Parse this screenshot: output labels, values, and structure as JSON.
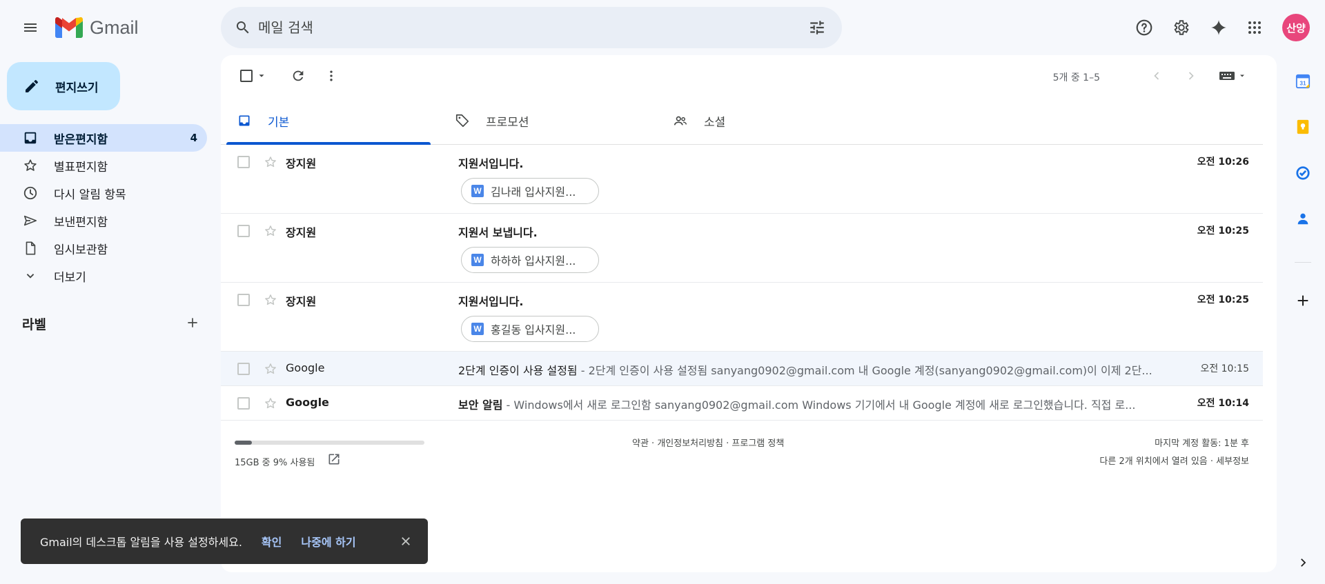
{
  "header": {
    "app_name": "Gmail",
    "search_placeholder": "메일 검색",
    "avatar_text": "산양"
  },
  "compose": {
    "label": "편지쓰기"
  },
  "nav": {
    "items": [
      {
        "label": "받은편지함",
        "count": "4",
        "icon": "inbox-icon",
        "active": true
      },
      {
        "label": "별표편지함",
        "icon": "star-icon"
      },
      {
        "label": "다시 알림 항목",
        "icon": "clock-icon"
      },
      {
        "label": "보낸편지함",
        "icon": "send-icon"
      },
      {
        "label": "임시보관함",
        "icon": "draft-icon"
      },
      {
        "label": "더보기",
        "icon": "chevron-down-icon"
      }
    ],
    "labels_heading": "라벨"
  },
  "toolbar": {
    "pager": "5개 중 1–5"
  },
  "tabs": [
    {
      "label": "기본",
      "icon": "inbox-icon",
      "active": true
    },
    {
      "label": "프로모션",
      "icon": "tag-icon"
    },
    {
      "label": "소셜",
      "icon": "people-icon"
    }
  ],
  "emails": [
    {
      "sender": "장지원",
      "subject": "지원서입니다.",
      "snippet": "",
      "time": "오전 10:26",
      "attachment": "김나래 입사지원...",
      "unread": true
    },
    {
      "sender": "장지원",
      "subject": "지원서 보냅니다.",
      "snippet": "",
      "time": "오전 10:25",
      "attachment": "하하하 입사지원...",
      "unread": true
    },
    {
      "sender": "장지원",
      "subject": "지원서입니다.",
      "snippet": "",
      "time": "오전 10:25",
      "attachment": "홍길동 입사지원...",
      "unread": true
    },
    {
      "sender": "Google",
      "subject": "2단계 인증이 사용 설정됨",
      "snippet": " - 2단계 인증이 사용 설정됨 sanyang0902@gmail.com 내 Google 계정(sanyang0902@gmail.com)이 이제 2단...",
      "time": "오전 10:15",
      "attachment": "",
      "unread": false
    },
    {
      "sender": "Google",
      "subject": "보안 알림",
      "snippet": " - Windows에서 새로 로그인함 sanyang0902@gmail.com Windows 기기에서 내 Google 계정에 새로 로그인했습니다. 직접 로...",
      "time": "오전 10:14",
      "attachment": "",
      "unread": true
    }
  ],
  "attachment_icon_letter": "W",
  "footer": {
    "storage_text": "15GB 중 9% 사용됨",
    "storage_fraction": 0.09,
    "links": "약관 · 개인정보처리방침 · 프로그램 정책",
    "activity_line1": "마지막 계정 활동: 1분 후",
    "activity_line2": "다른 2개 위치에서 열려 있음 · 세부정보"
  },
  "snackbar": {
    "message": "Gmail의 데스크톱 알림을 사용 설정하세요.",
    "confirm": "확인",
    "later": "나중에 하기"
  },
  "side_panel": {
    "calendar_day": "31",
    "icons": [
      "calendar-icon",
      "keep-icon",
      "tasks-icon",
      "contacts-icon",
      "add-icon"
    ]
  },
  "colors": {
    "accent": "#0b57d0",
    "compose_bg": "#c2e7ff",
    "nav_active_bg": "#d3e3fd",
    "avatar_bg": "#e8467c",
    "background": "#f6f8fc"
  }
}
